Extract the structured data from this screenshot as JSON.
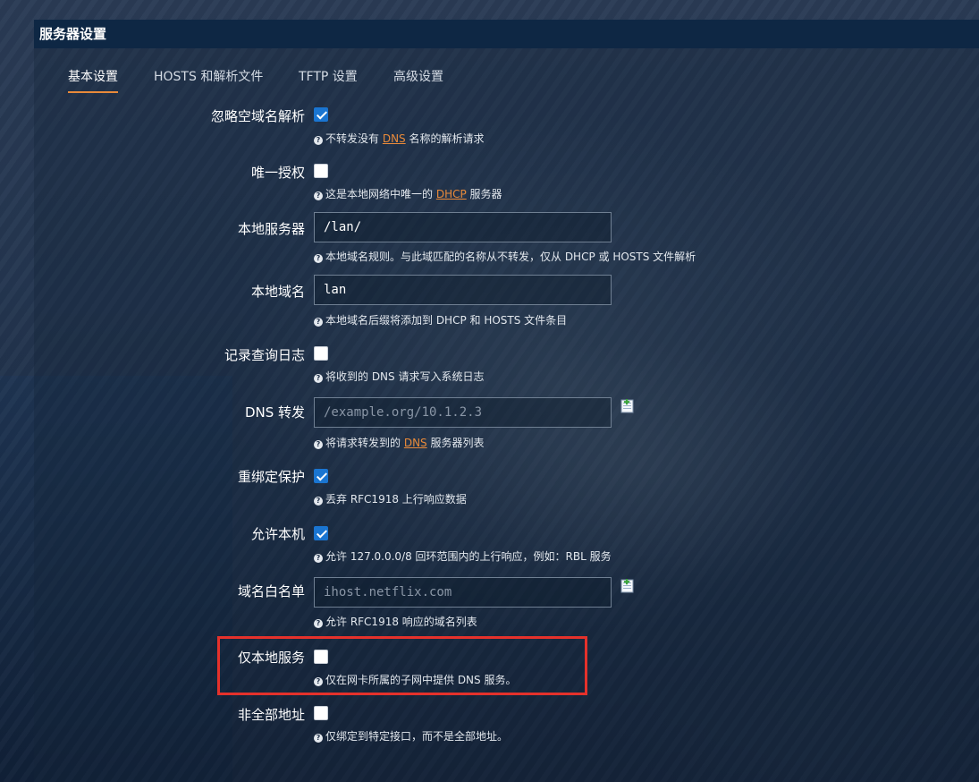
{
  "panel": {
    "title": "服务器设置"
  },
  "tabs": [
    "基本设置",
    "HOSTS 和解析文件",
    "TFTP 设置",
    "高级设置"
  ],
  "accent_color": "#e98a3a",
  "highlight_color": "#e5312b",
  "rows": [
    {
      "label": "忽略空域名解析",
      "checked": true,
      "help_pre": "不转发没有 ",
      "help_link": "DNS",
      "help_post": " 名称的解析请求"
    },
    {
      "label": "唯一授权",
      "checked": false,
      "help_pre": "这是本地网络中唯一的 ",
      "help_link": "DHCP",
      "help_post": " 服务器"
    },
    {
      "label": "本地服务器",
      "value": "/lan/",
      "help": "本地域名规则。与此域匹配的名称从不转发，仅从 DHCP 或 HOSTS 文件解析"
    },
    {
      "label": "本地域名",
      "value": "lan",
      "help": "本地域名后缀将添加到 DHCP 和 HOSTS 文件条目"
    },
    {
      "label": "记录查询日志",
      "checked": false,
      "help": "将收到的 DNS 请求写入系统日志"
    },
    {
      "label": "DNS 转发",
      "placeholder": "/example.org/10.1.2.3",
      "help_pre": "将请求转发到的 ",
      "help_link": "DNS",
      "help_post": " 服务器列表"
    },
    {
      "label": "重绑定保护",
      "checked": true,
      "help": "丢弃 RFC1918 上行响应数据"
    },
    {
      "label": "允许本机",
      "checked": true,
      "help": "允许 127.0.0.0/8 回环范围内的上行响应，例如：RBL 服务"
    },
    {
      "label": "域名白名单",
      "placeholder": "ihost.netflix.com",
      "help": "允许 RFC1918 响应的域名列表"
    },
    {
      "label": "仅本地服务",
      "checked": false,
      "help": "仅在网卡所属的子网中提供 DNS 服务。"
    },
    {
      "label": "非全部地址",
      "checked": false,
      "help": "仅绑定到特定接口，而不是全部地址。"
    }
  ]
}
